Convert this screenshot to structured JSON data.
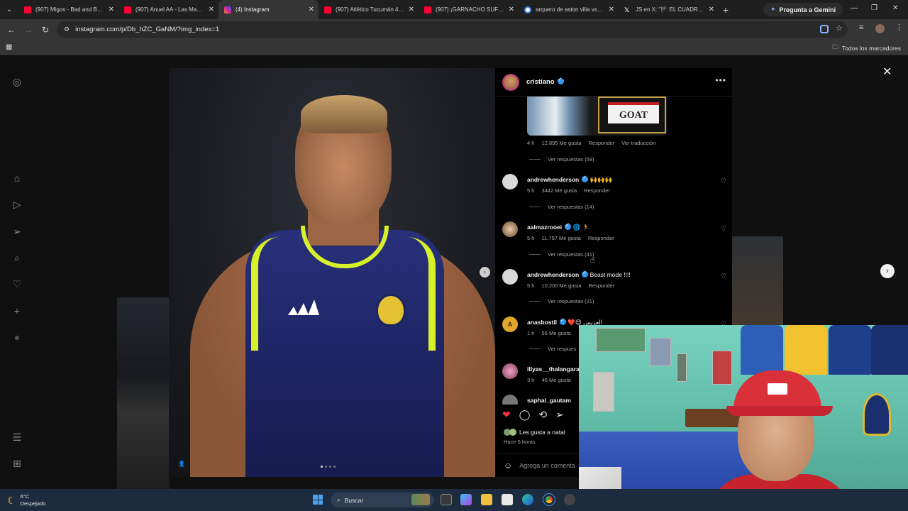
{
  "browser": {
    "tabs": [
      {
        "title": "(907) Migos - Bad and Bo...",
        "favicon_color": "#ff0033",
        "active": false
      },
      {
        "title": "(907) Anuel AA - Las Mas ...",
        "favicon_color": "#ff0033",
        "active": false
      },
      {
        "title": "(4) Instagram",
        "favicon_color": "#d6249f",
        "active": true
      },
      {
        "title": "(907) Atlético Tucumán 4 ...",
        "favicon_color": "#ff0033",
        "active": false
      },
      {
        "title": "(907) ¡GARNACHO SUFRIÓ...",
        "favicon_color": "#ff0033",
        "active": false
      },
      {
        "title": "arquero de aston villa vs p...",
        "favicon_color": "#4285f4",
        "active": false
      },
      {
        "title": "JS en X: \"🏴 EL CUADRO D...",
        "favicon_color": "#ffffff",
        "active": false
      }
    ],
    "gemini_label": "Pregunta a Gemini",
    "url": "instagram.com/p/Db_hZC_GaNM/?img_index=1",
    "bookmarks_all": "Todos los marcadores"
  },
  "post": {
    "username": "cristiano",
    "goat_text": "GOAT",
    "first_comment_meta": {
      "time": "4 h",
      "likes": "12.895 Me gusta",
      "reply": "Responder",
      "translate": "Ver traducción"
    },
    "first_replies": "Ver respuestas (59)",
    "comments": [
      {
        "user": "andrewhenderson",
        "text": "🙌🙌🙌",
        "time": "5 h",
        "likes": "3442 Me gusta",
        "reply": "Responder",
        "replies": "Ver respuestas (14)",
        "avatar_color": "#cfcfcf"
      },
      {
        "user": "aalmazrooei",
        "text": "🌐 🏃",
        "time": "5 h",
        "likes": "11.757 Me gusta",
        "reply": "Responder",
        "replies": "Ver respuestas (41)",
        "avatar_color": "#9a6a4a"
      },
      {
        "user": "andrewhenderson",
        "text": "Beast mode !!!!",
        "time": "5 h",
        "likes": "10.200 Me gusta",
        "reply": "Responder",
        "replies": "Ver respuestas (21)",
        "avatar_color": "#cfcfcf"
      },
      {
        "user": "anasbostil",
        "text": "❤️😍 العريس",
        "time": "1 h",
        "likes": "56 Me gusta",
        "reply": "",
        "replies": "Ver respues",
        "avatar_color": "#e0a52a"
      },
      {
        "user": "illyas__thalangara",
        "text": "",
        "time": "3 h",
        "likes": "46 Me gusta",
        "reply": "",
        "replies": "",
        "avatar_color": "#c05080"
      },
      {
        "user": "saphal_gautam",
        "text": "",
        "time": "",
        "likes": "",
        "reply": "",
        "replies": "",
        "avatar_color": "#777777"
      }
    ],
    "liked_by": "Les gusta a natal",
    "posted_ago": "Hace 5 horas",
    "add_comment_placeholder": "Agrega un comenta"
  },
  "taskbar": {
    "temp": "6°C",
    "weather": "Despejado",
    "search_label": "Buscar"
  }
}
